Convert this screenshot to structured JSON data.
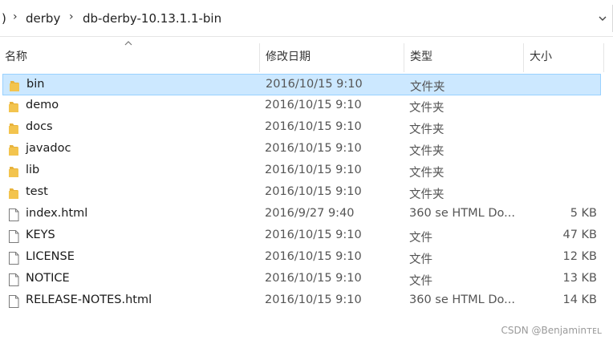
{
  "breadcrumb": {
    "cut": ")",
    "items": [
      "derby",
      "db-derby-10.13.1.1-bin"
    ]
  },
  "columns": {
    "name": "名称",
    "date": "修改日期",
    "type": "类型",
    "size": "大小"
  },
  "files": [
    {
      "name": "bin",
      "date": "2016/10/15 9:10",
      "type": "文件夹",
      "size": "",
      "icon": "folder-icon",
      "selected": true
    },
    {
      "name": "demo",
      "date": "2016/10/15 9:10",
      "type": "文件夹",
      "size": "",
      "icon": "folder-icon"
    },
    {
      "name": "docs",
      "date": "2016/10/15 9:10",
      "type": "文件夹",
      "size": "",
      "icon": "folder-icon"
    },
    {
      "name": "javadoc",
      "date": "2016/10/15 9:10",
      "type": "文件夹",
      "size": "",
      "icon": "folder-icon"
    },
    {
      "name": "lib",
      "date": "2016/10/15 9:10",
      "type": "文件夹",
      "size": "",
      "icon": "folder-icon"
    },
    {
      "name": "test",
      "date": "2016/10/15 9:10",
      "type": "文件夹",
      "size": "",
      "icon": "folder-icon"
    },
    {
      "name": "index.html",
      "date": "2016/9/27 9:40",
      "type": "360 se HTML Do...",
      "size": "5 KB",
      "icon": "file-icon"
    },
    {
      "name": "KEYS",
      "date": "2016/10/15 9:10",
      "type": "文件",
      "size": "47 KB",
      "icon": "file-icon"
    },
    {
      "name": "LICENSE",
      "date": "2016/10/15 9:10",
      "type": "文件",
      "size": "12 KB",
      "icon": "file-icon"
    },
    {
      "name": "NOTICE",
      "date": "2016/10/15 9:10",
      "type": "文件",
      "size": "13 KB",
      "icon": "file-icon"
    },
    {
      "name": "RELEASE-NOTES.html",
      "date": "2016/10/15 9:10",
      "type": "360 se HTML Do...",
      "size": "14 KB",
      "icon": "file-icon"
    }
  ],
  "watermark": "CSDN @Benjaminᴛᴇʟ",
  "colors": {
    "selected_bg": "#cce8ff",
    "selected_border": "#99d1ff",
    "folder": "#f3c44e"
  }
}
